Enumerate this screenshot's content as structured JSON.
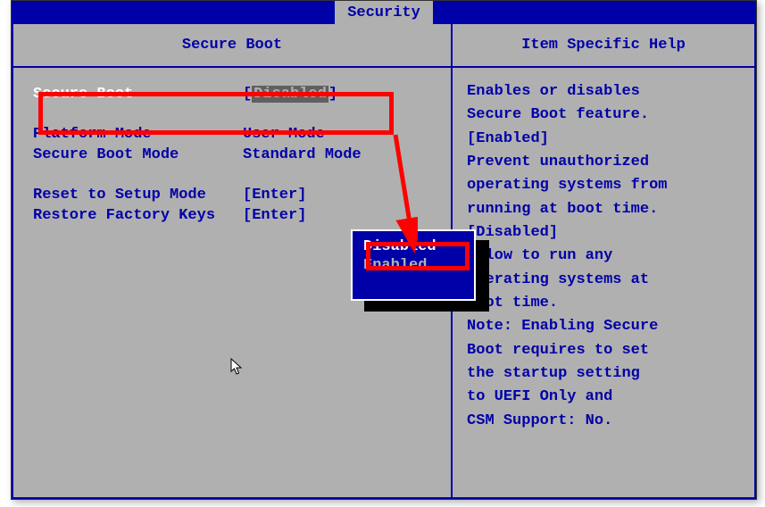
{
  "tab": "Security",
  "leftHeader": "Secure Boot",
  "rightHeader": "Item Specific Help",
  "rows": {
    "secureBoot": {
      "label": "Secure Boot",
      "value": "Disabled"
    },
    "platformMode": {
      "label": "Platform Mode",
      "value": "User Mode"
    },
    "secureBootMode": {
      "label": "Secure Boot Mode",
      "value": "Standard Mode"
    },
    "resetSetup": {
      "label": "Reset to Setup Mode",
      "value": "[Enter]"
    },
    "restoreKeys": {
      "label": "Restore Factory Keys",
      "value": "[Enter]"
    }
  },
  "popup": {
    "option1": "Disabled",
    "option2": "Enabled"
  },
  "help": {
    "line1": "Enables or disables",
    "line2": "Secure Boot feature.",
    "line3": "[Enabled]",
    "line4": "Prevent unauthorized",
    "line5": "operating systems from",
    "line6": "running at boot time.",
    "line7": "[Disabled]",
    "line8": "Allow to run any",
    "line9": "operating systems at",
    "line10": "boot time.",
    "line11": "Note: Enabling Secure",
    "line12": "Boot requires to set",
    "line13": "the startup setting",
    "line14": "to UEFI Only and",
    "line15": "CSM Support:  No."
  },
  "bracketOpen": "[",
  "bracketClose": "]"
}
